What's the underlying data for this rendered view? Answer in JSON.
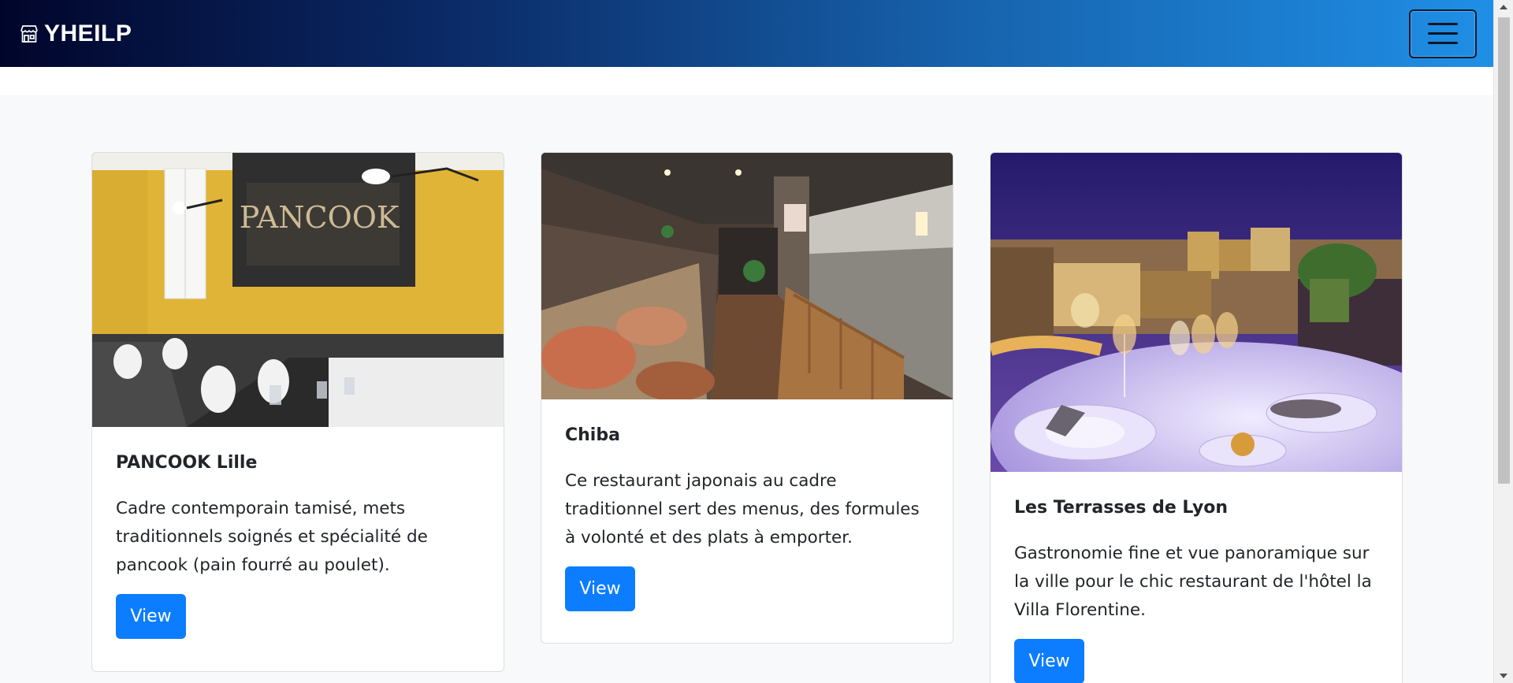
{
  "brand": {
    "name": "YHEILP",
    "icon": "shop-icon"
  },
  "menu": {
    "icon": "hamburger-icon"
  },
  "cards": [
    {
      "title": "PANCOOK Lille",
      "text": "Cadre contemporain tamisé, mets traditionnels soignés et spécialité de pancook (pain fourré au poulet).",
      "button": "View",
      "image": "yellow-restaurant-interior-photo",
      "sign_text": "PANCOOK"
    },
    {
      "title": "Chiba",
      "text": "Ce restaurant japonais au cadre traditionnel sert des menus, des formules à volonté et des plats à emporter.",
      "button": "View",
      "image": "japanese-buffet-interior-photo"
    },
    {
      "title": "Les Terrasses de Lyon",
      "text": "Gastronomie fine et vue panoramique sur la ville pour le chic restaurant de l'hôtel la Villa Florentine.",
      "button": "View",
      "image": "night-terrace-dining-photo"
    }
  ],
  "colors": {
    "primary": "#0d7dff",
    "nav_start": "#01052b",
    "nav_end": "#1f8fe6",
    "page_bg": "#f8f9fa"
  }
}
